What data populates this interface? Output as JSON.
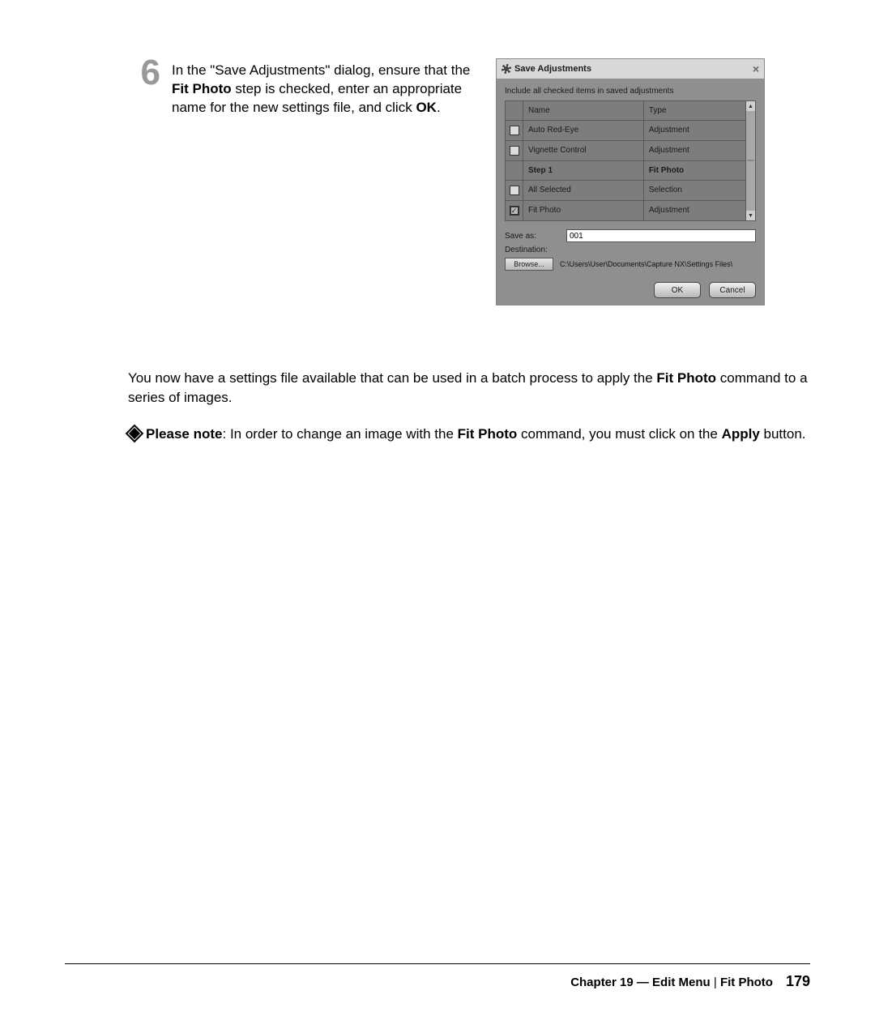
{
  "step": {
    "number": "6",
    "text_pre": "In the \"Save Adjustments\" dialog, ensure that the ",
    "bold1": "Fit Photo",
    "text_mid": " step is checked, enter an appropriate name for the new settings file, and click ",
    "bold2": "OK",
    "text_end": "."
  },
  "dialog": {
    "title": "Save Adjustments",
    "close": "×",
    "instruction": "Include all checked items in saved adjustments",
    "headers": {
      "name": "Name",
      "type": "Type"
    },
    "rows": [
      {
        "checked": false,
        "name": "Auto Red-Eye",
        "type": "Adjustment",
        "section": false,
        "hasChk": true
      },
      {
        "checked": false,
        "name": "Vignette Control",
        "type": "Adjustment",
        "section": false,
        "hasChk": true
      },
      {
        "checked": false,
        "name": "Step 1",
        "type": "Fit Photo",
        "section": true,
        "hasChk": false
      },
      {
        "checked": false,
        "name": "All Selected",
        "type": "Selection",
        "section": false,
        "hasChk": true
      },
      {
        "checked": true,
        "name": "Fit Photo",
        "type": "Adjustment",
        "section": false,
        "hasChk": true
      }
    ],
    "save_as_label": "Save as:",
    "save_as_value": "001",
    "destination_label": "Destination:",
    "browse_label": "Browse...",
    "destination_path": "C:\\Users\\User\\Documents\\Capture NX\\Settings Files\\",
    "ok": "OK",
    "cancel": "Cancel"
  },
  "para1": {
    "pre": "You now have a settings file available that can be used in a batch process to apply the ",
    "bold": "Fit Photo",
    "post": " command to a series of images."
  },
  "note": {
    "lead": "Please note",
    "t1": ": In order to change an image with the ",
    "b1": "Fit Photo",
    "t2": " command, you must click on the ",
    "b2": "Apply",
    "t3": " button."
  },
  "footer": {
    "chapter": "Chapter 19 — Edit Menu",
    "section": "Fit Photo",
    "page": "179"
  }
}
